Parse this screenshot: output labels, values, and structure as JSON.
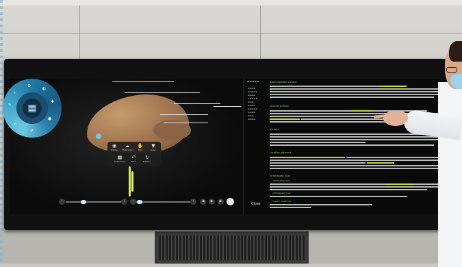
{
  "viewer": {
    "tools": [
      {
        "name": "hide-tool",
        "glyph": "◉",
        "label": "Hidden"
      },
      {
        "name": "undo-tool",
        "glyph": "☁",
        "label": "Multi-View"
      },
      {
        "name": "pass-tool",
        "glyph": "✋",
        "label": "Pass"
      },
      {
        "name": "color-tool",
        "glyph": "▼",
        "label": "Color"
      },
      {
        "name": "multiselect-tool",
        "glyph": "▦",
        "label": "Multiselect"
      },
      {
        "name": "back-tool",
        "glyph": "↶",
        "label": "Back"
      },
      {
        "name": "restore-tool",
        "glyph": "↻",
        "label": "Restore"
      }
    ]
  },
  "text_panel": {
    "close_label": "Close",
    "headings": [
      "diaphragmatic surface",
      "visceral surface",
      "borders",
      "Location,adjacent",
      "intrahepatic duct",
      "intrahepatic duct",
      "extrahepatic duct",
      "hepatic portal vein"
    ]
  },
  "colors": {
    "accent_green": "#8cd26b",
    "highlight_yellow": "#c8dc3c",
    "wheel_blue": "#2d8fb8"
  }
}
